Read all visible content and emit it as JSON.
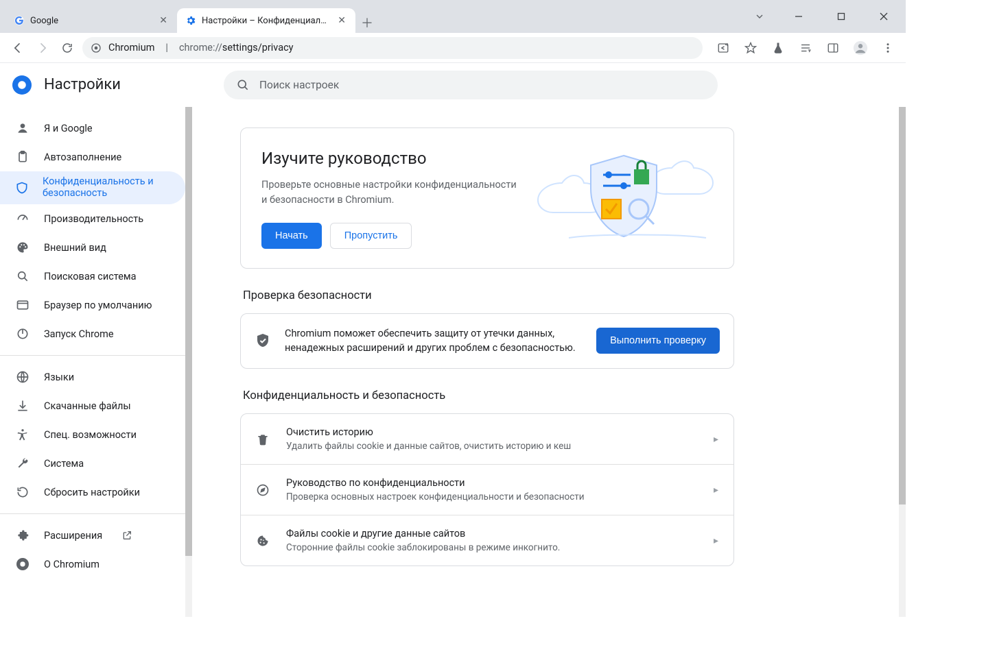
{
  "window": {
    "tabs": [
      {
        "title": "Google",
        "active": false
      },
      {
        "title": "Настройки – Конфиденциально",
        "active": true
      }
    ]
  },
  "addressbar": {
    "origin_label": "Chromium",
    "url_prefix": "chrome://",
    "url_path": "settings/privacy"
  },
  "header": {
    "title": "Настройки",
    "search_placeholder": "Поиск настроек"
  },
  "sidebar": {
    "section1": [
      {
        "id": "you",
        "label": "Я и Google",
        "icon": "person"
      },
      {
        "id": "autofill",
        "label": "Автозаполнение",
        "icon": "clipboard"
      },
      {
        "id": "privacy",
        "label": "Конфиденциальность и безопасность",
        "icon": "shield",
        "active": true
      },
      {
        "id": "performance",
        "label": "Производительность",
        "icon": "speed"
      },
      {
        "id": "appearance",
        "label": "Внешний вид",
        "icon": "palette"
      },
      {
        "id": "search",
        "label": "Поисковая система",
        "icon": "magnifier"
      },
      {
        "id": "default",
        "label": "Браузер по умолчанию",
        "icon": "window"
      },
      {
        "id": "onstart",
        "label": "Запуск Chrome",
        "icon": "power"
      }
    ],
    "section2": [
      {
        "id": "languages",
        "label": "Языки",
        "icon": "globe"
      },
      {
        "id": "downloads",
        "label": "Скачанные файлы",
        "icon": "download"
      },
      {
        "id": "accessibility",
        "label": "Спец. возможности",
        "icon": "accessibility"
      },
      {
        "id": "system",
        "label": "Система",
        "icon": "wrench"
      },
      {
        "id": "reset",
        "label": "Сбросить настройки",
        "icon": "reset"
      }
    ],
    "section3": [
      {
        "id": "extensions",
        "label": "Расширения",
        "icon": "puzzle",
        "external": true
      },
      {
        "id": "about",
        "label": "О Chromium",
        "icon": "chromium"
      }
    ]
  },
  "main": {
    "hero": {
      "title": "Изучите руководство",
      "body": "Проверьте основные настройки конфиденциальности и безопасности в Chromium.",
      "start": "Начать",
      "skip": "Пропустить"
    },
    "safety": {
      "section_title": "Проверка безопасности",
      "text": "Chromium поможет обеспечить защиту от утечки данных, ненадежных расширений и других проблем с безопасностью.",
      "button": "Выполнить проверку"
    },
    "privacy": {
      "section_title": "Конфиденциальность и безопасность",
      "items": [
        {
          "title": "Очистить историю",
          "sub": "Удалить файлы cookie и данные сайтов, очистить историю и кеш",
          "icon": "trash"
        },
        {
          "title": "Руководство по конфиденциальности",
          "sub": "Проверка основных настроек конфиденциальности и безопасности",
          "icon": "compass"
        },
        {
          "title": "Файлы cookie и другие данные сайтов",
          "sub": "Сторонние файлы cookie заблокированы в режиме инкогнито.",
          "icon": "cookie"
        }
      ]
    }
  }
}
